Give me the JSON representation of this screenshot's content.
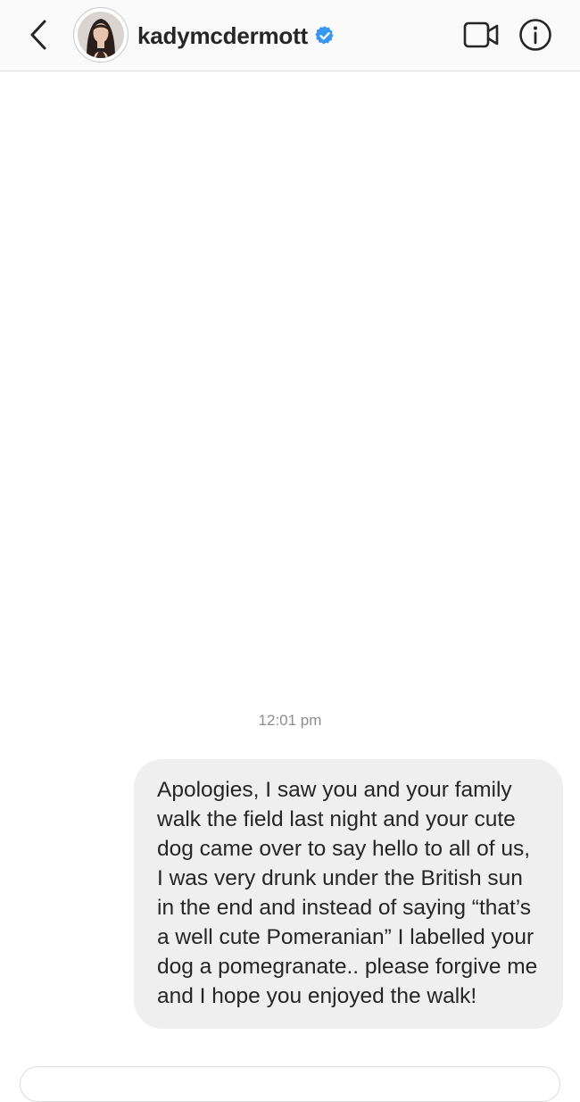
{
  "header": {
    "back_icon": "chevron-left-icon",
    "avatar_icon": "profile-photo",
    "username": "kadymcdermott",
    "verified_icon": "verified-badge-icon",
    "verified_color": "#3897f0",
    "video_icon": "video-call-icon",
    "info_icon": "info-icon"
  },
  "thread": {
    "timestamp": "12:01 pm",
    "messages": [
      {
        "direction": "outgoing",
        "text": "Apologies, I saw you and your family walk the field last night and your cute dog came over to say hello to all of us, I was very drunk under the British sun in the end and instead of saying “that’s a well cute Pomeranian” I labelled your dog a pomegranate.. please forgive me and I hope you enjoyed the walk!"
      }
    ]
  }
}
